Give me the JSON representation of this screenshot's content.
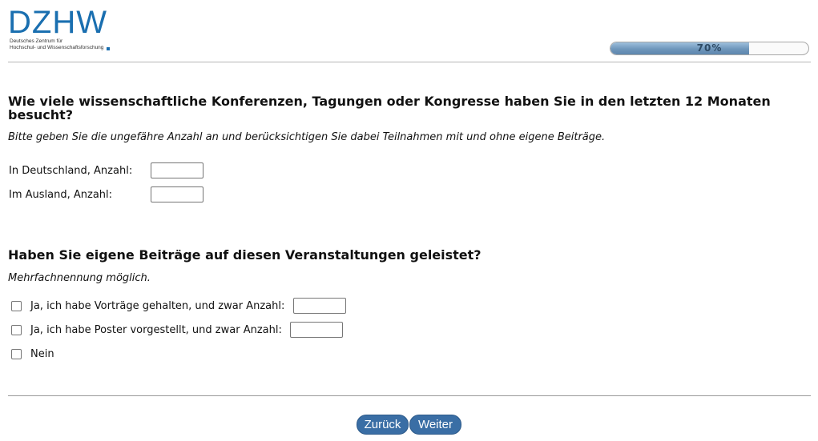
{
  "header": {
    "logo": {
      "wordmark": "DZHW",
      "subtitle_line1": "Deutsches Zentrum für",
      "subtitle_line2": "Hochschul- und Wissenschaftsforschung"
    },
    "progress": {
      "percent": 70,
      "label": "70%"
    }
  },
  "question1": {
    "title": "Wie viele wissenschaftliche Konferenzen, Tagungen oder Kongresse haben Sie in den letzten 12 Monaten besucht?",
    "hint": "Bitte geben Sie die ungefähre Anzahl an und berücksichtigen Sie dabei Teilnahmen mit und ohne eigene Beiträge.",
    "fields": [
      {
        "label": "In Deutschland, Anzahl:",
        "value": ""
      },
      {
        "label": "Im Ausland, Anzahl:",
        "value": ""
      }
    ]
  },
  "question2": {
    "title": "Haben Sie eigene Beiträge auf diesen Veranstaltungen geleistet?",
    "hint": "Mehrfachnennung möglich.",
    "options": [
      {
        "label": "Ja, ich habe Vorträge gehalten, und zwar Anzahl:",
        "checked": false,
        "count": ""
      },
      {
        "label": "Ja, ich habe Poster vorgestellt, und zwar Anzahl:",
        "checked": false,
        "count": ""
      },
      {
        "label": "Nein",
        "checked": false
      }
    ]
  },
  "navigation": {
    "back_label": "Zurück",
    "next_label": "Weiter"
  },
  "colors": {
    "brand": "#1a6fb0",
    "button": "#3a6ea5",
    "progress_fill": "#6f96bb"
  }
}
